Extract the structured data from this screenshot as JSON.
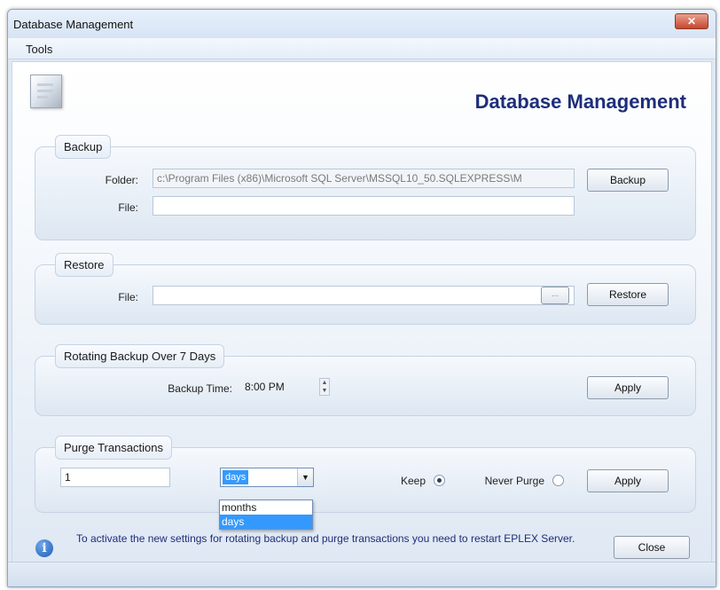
{
  "window": {
    "title": "Database Management",
    "close_symbol": "✕"
  },
  "menu": {
    "items": [
      "Tools"
    ]
  },
  "header": {
    "title": "Database Management"
  },
  "backup": {
    "group_title": "Backup",
    "folder_label": "Folder:",
    "folder_value": "c:\\Program Files (x86)\\Microsoft SQL Server\\MSSQL10_50.SQLEXPRESS\\M",
    "file_label": "File:",
    "file_value": "",
    "button_label": "Backup"
  },
  "restore": {
    "group_title": "Restore",
    "file_label": "File:",
    "file_value": "",
    "browse_label": "...",
    "button_label": "Restore"
  },
  "rotating": {
    "group_title": "Rotating Backup Over 7 Days",
    "time_label": "Backup Time:",
    "time_value": "8:00 PM",
    "apply_label": "Apply"
  },
  "purge": {
    "group_title": "Purge Transactions",
    "amount_value": "1",
    "unit_selected": "days",
    "unit_options": [
      "months",
      "days"
    ],
    "keep_label": "Keep",
    "keep_checked": true,
    "never_purge_label": "Never Purge",
    "never_purge_checked": false,
    "apply_label": "Apply"
  },
  "footer": {
    "info_icon": "i",
    "message": "To activate the new settings for rotating backup and purge transactions you need to restart EPLEX Server.",
    "close_label": "Close"
  },
  "colors": {
    "accent_title": "#1d2e7a",
    "selection": "#3399ff",
    "background": "#dfe9f5"
  }
}
